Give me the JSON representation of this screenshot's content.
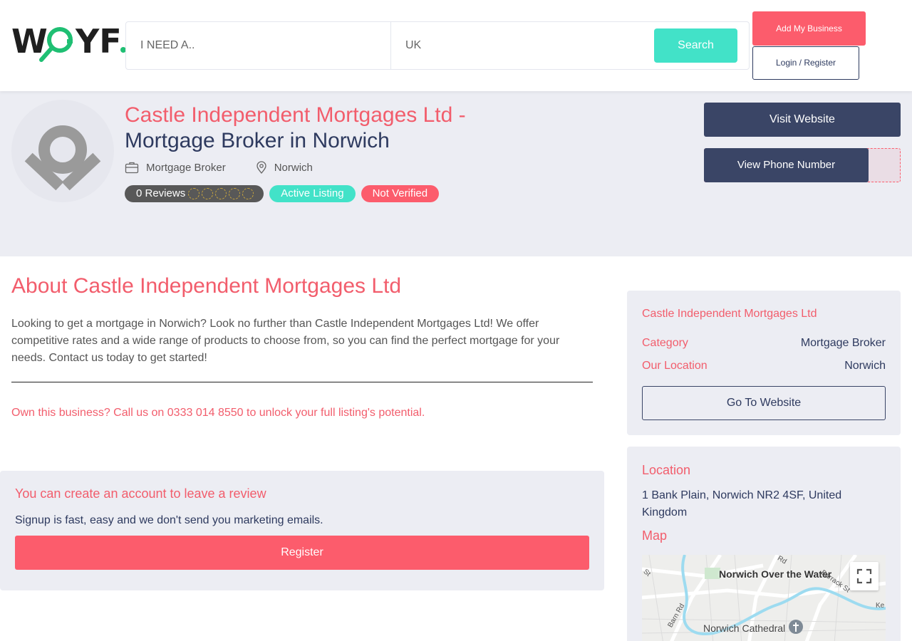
{
  "header": {
    "logo_text": "WGYF.",
    "search_need_placeholder": "I NEED A..",
    "search_location_value": "UK",
    "search_button": "Search",
    "add_business_button": "Add My Business",
    "login_button": "Login / Register"
  },
  "hero": {
    "title_part1": "Castle Independent Mortgages Ltd -",
    "title_part2": "Mortgage Broker in Norwich",
    "category": "Mortgage Broker",
    "location": "Norwich",
    "reviews_label": "0 Reviews",
    "rating": 0,
    "active_badge": "Active Listing",
    "verified_badge": "Not Verified",
    "visit_button": "Visit Website",
    "phone_button": "View Phone Number"
  },
  "about": {
    "title": "About Castle Independent Mortgages Ltd",
    "text": "Looking to get a mortgage in Norwich? Look no further than Castle Independent Mortgages Ltd! We offer competitive rates and a wide range of products to choose from, so you can find the perfect mortgage for your needs. Contact us today to get started!",
    "own_text": "Own this business? Call us on 0333 014 8550 to unlock your full listing's potential."
  },
  "review_box": {
    "title": "You can create an account to leave a review",
    "subtitle": "Signup is fast, easy and we don't send you marketing emails.",
    "register_button": "Register"
  },
  "sidebar": {
    "business_name": "Castle Independent Mortgages Ltd",
    "category_label": "Category",
    "category_value": "Mortgage Broker",
    "location_label": "Our Location",
    "location_value": "Norwich",
    "website_button": "Go To Website",
    "location_title": "Location",
    "address": "1 Bank Plain, Norwich NR2 4SF, United Kingdom",
    "map_title": "Map",
    "map_labels": {
      "area": "Norwich Over the Water",
      "cathedral": "Norwich Cathedral",
      "street1": "Barrack St",
      "street2": "Barn Rd",
      "street3": "Rd",
      "street4": "St",
      "street5": "Ke"
    }
  },
  "colors": {
    "accent_red": "#fc5c6c",
    "accent_teal": "#42e2c8",
    "navy": "#3a4566",
    "panel_bg": "#ecedf3"
  }
}
